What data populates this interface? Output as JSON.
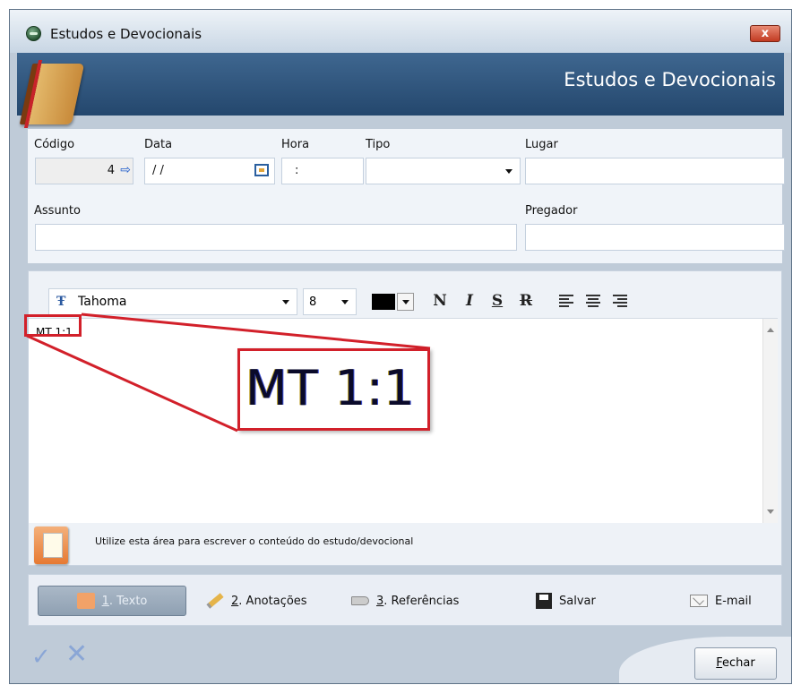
{
  "window": {
    "title": "Estudos e Devocionais",
    "close_label": "x"
  },
  "header": {
    "title": "Estudos e Devocionais"
  },
  "form": {
    "codigo_label": "Código",
    "codigo_value": "4",
    "data_label": "Data",
    "data_value": "/ /",
    "hora_label": "Hora",
    "hora_value": ":",
    "tipo_label": "Tipo",
    "tipo_value": "",
    "lugar_label": "Lugar",
    "lugar_value": "",
    "assunto_label": "Assunto",
    "assunto_value": "",
    "pregador_label": "Pregador",
    "pregador_value": ""
  },
  "toolbar": {
    "font": "Tahoma",
    "size": "8",
    "color": "#000000",
    "bold_label": "N",
    "italic_label": "I",
    "underline_label": "S",
    "strike_label": "R"
  },
  "editor": {
    "content": "MT 1:1"
  },
  "hint": {
    "text": "Utilize esta área para escrever o conteúdo do estudo/devocional"
  },
  "tabs": [
    {
      "num": "1",
      "label": ". Texto"
    },
    {
      "num": "2",
      "label": ". Anotações"
    },
    {
      "num": "3",
      "label": ". Referências"
    },
    {
      "label": "Salvar"
    },
    {
      "label": "E-mail"
    }
  ],
  "footer": {
    "fechar_accel": "F",
    "fechar_rest": "echar"
  },
  "callout": {
    "text": "MT 1:1"
  },
  "icons": [
    "app-icon",
    "close-icon",
    "book-icon",
    "arrow-right-icon",
    "calendar-icon",
    "font-icon",
    "folder-icon",
    "pencil-icon",
    "tag-icon",
    "save-icon",
    "mail-icon",
    "check-icon",
    "x-icon"
  ],
  "colors": {
    "banner": "#2f547d",
    "callout": "#d2202a",
    "window": "#bfcbd8"
  }
}
